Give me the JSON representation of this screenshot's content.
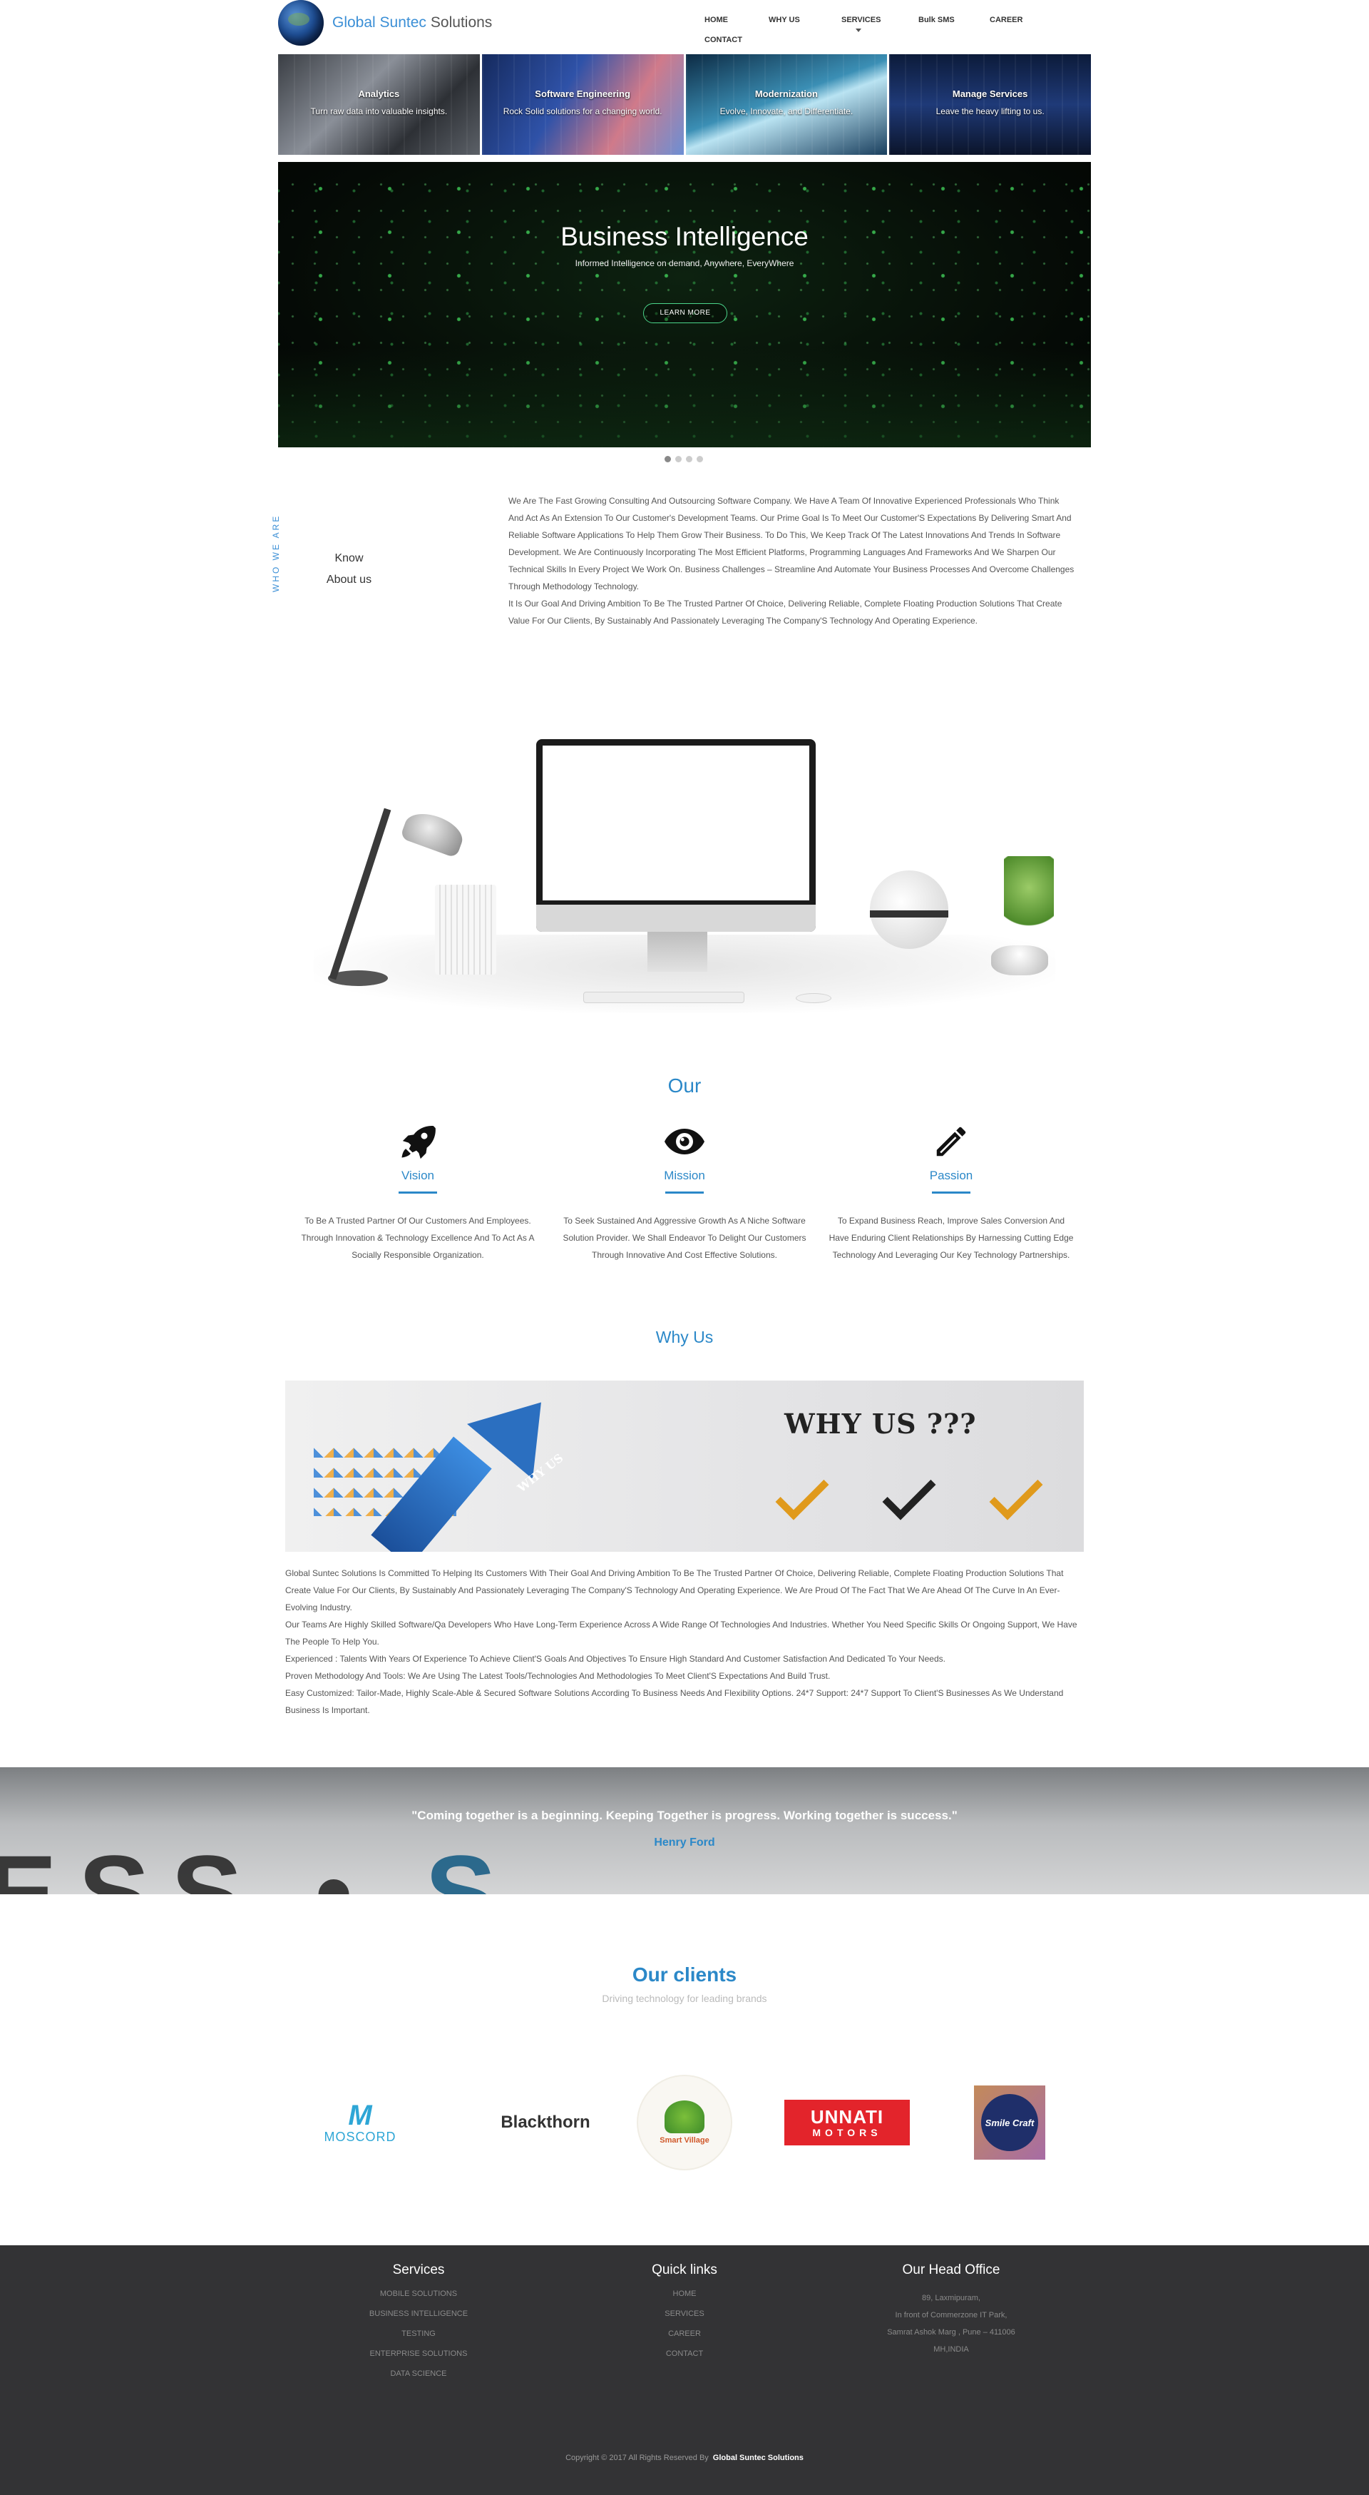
{
  "brand": {
    "name_part1": "Global Suntec",
    "name_part2": "Solutions"
  },
  "nav": {
    "items": [
      "HOME",
      "WHY US",
      "SERVICES",
      "Bulk SMS",
      "CAREER",
      "CONTACT"
    ]
  },
  "tiles": [
    {
      "title": "Analytics",
      "subtitle": "Turn raw data into valuable insights."
    },
    {
      "title": "Software Engineering",
      "subtitle": "Rock Solid solutions for a changing world."
    },
    {
      "title": "Modernization",
      "subtitle": "Evolve, Innovate, and Differentiate."
    },
    {
      "title": "Manage Services",
      "subtitle": "Leave the heavy lifting to us."
    }
  ],
  "hero": {
    "title": "Business Intelligence",
    "subtitle": "Informed Intelligence on demand, Anywhere, EveryWhere",
    "button": "LEARN MORE"
  },
  "about": {
    "vertical_label": "WHO WE ARE",
    "know_label_1": "Know",
    "know_label_2": "About us",
    "paragraph_1": "We Are The Fast Growing Consulting And Outsourcing Software Company. We Have A Team Of Innovative Experienced Professionals Who Think And Act As An Extension To Our Customer's Development Teams. Our Prime Goal Is To Meet Our Customer'S Expectations By Delivering Smart And Reliable Software Applications To Help Them Grow Their Business. To Do This, We Keep Track Of The Latest Innovations And Trends In Software Development. We Are Continuously Incorporating The Most Efficient Platforms, Programming Languages And Frameworks And We Sharpen Our Technical Skills In Every Project We Work On. Business Challenges – Streamline And Automate Your Business Processes And Overcome Challenges Through Methodology Technology.",
    "paragraph_2": "It Is Our Goal And Driving Ambition To Be The Trusted Partner Of Choice, Delivering Reliable, Complete Floating Production Solutions That Create Value For Our Clients, By Sustainably And Passionately Leveraging The Company'S Technology And Operating Experience."
  },
  "our": {
    "title": "Our",
    "pillars": [
      {
        "title": "Vision",
        "text": "To Be A Trusted Partner Of Our Customers And Employees. Through Innovation & Technology Excellence And To Act As A Socially Responsible Organization."
      },
      {
        "title": "Mission",
        "text": "To Seek Sustained And Aggressive Growth As A Niche Software Solution Provider. We Shall Endeavor To Delight Our Customers Through Innovative And Cost Effective Solutions."
      },
      {
        "title": "Passion",
        "text": "To Expand Business Reach, Improve Sales Conversion And Have Enduring Client Relationships By Harnessing Cutting Edge Technology And Leveraging Our Key Technology Partnerships."
      }
    ]
  },
  "why": {
    "title": "Why Us",
    "banner_text": "WHY US ???",
    "banner_arrow_text": "WHY US",
    "lines": [
      "Global Suntec Solutions Is Committed To Helping Its Customers With Their Goal And Driving Ambition To Be The Trusted Partner Of Choice, Delivering Reliable, Complete Floating Production Solutions That Create Value For Our Clients, By Sustainably And Passionately Leveraging The Company'S Technology And Operating Experience. We Are Proud Of The Fact That We Are Ahead Of The Curve In An Ever-Evolving Industry.",
      "Our Teams Are Highly Skilled Software/Qa Developers Who Have Long-Term Experience Across A Wide Range Of Technologies And Industries. Whether You Need Specific Skills Or Ongoing Support, We Have The People To Help You.",
      "Experienced : Talents With Years Of Experience To Achieve Client'S Goals And Objectives To Ensure High Standard And Customer Satisfaction And Dedicated To Your Needs.",
      "Proven Methodology And Tools: We Are Using The Latest Tools/Technologies And Methodologies To Meet Client'S Expectations And Build Trust.",
      "Easy Customized: Tailor-Made, Highly Scale-Able & Secured Software Solutions According To Business Needs And Flexibility Options. 24*7 Support: 24*7 Support To Client'S Businesses As We Understand Business Is Important."
    ]
  },
  "quote": {
    "text": "\"Coming together is a beginning. Keeping Together is progress. Working together is success.\"",
    "author": "Henry Ford",
    "bg_text_1": "ESS",
    "bg_text_2": "S"
  },
  "clients": {
    "title": "Our clients",
    "subtitle": "Driving technology for leading brands",
    "moscord_mark": "M",
    "moscord": "MOSCORD",
    "blackthorn": "Blackthorn",
    "smart_village": "Smart Village",
    "unnati_1": "UNNATI",
    "unnati_2": "MOTORS",
    "smile_craft": "Smile Craft"
  },
  "footer": {
    "services_title": "Services",
    "services": [
      "MOBILE SOLUTIONS",
      "BUSINESS INTELLIGENCE",
      "TESTING",
      "ENTERPRISE SOLUTIONS",
      "DATA SCIENCE"
    ],
    "quick_title": "Quick links",
    "quick": [
      "HOME",
      "SERVICES",
      "CAREER",
      "CONTACT"
    ],
    "office_title": "Our Head Office",
    "address": [
      "89, Laxmipuram,",
      "In front of Commerzone IT Park,",
      "Samrat Ashok Marg , Pune – 411006",
      "MH,INDIA"
    ],
    "copyright": "Copyright © 2017 All Rights Reserved By",
    "copyright_brand": "Global Suntec Solutions"
  },
  "colors": {
    "accent": "#2b88c8",
    "footer_bg": "#333335",
    "hero_glow": "#4bd58a"
  }
}
